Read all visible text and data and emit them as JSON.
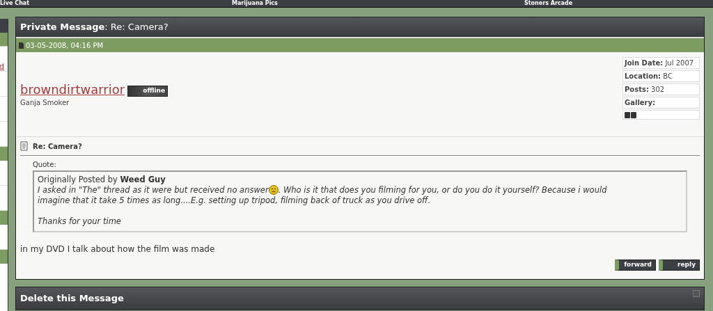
{
  "nav": [
    "Live Chat",
    "Marijuana Pics",
    "Stoners Arcade"
  ],
  "sidebar_link": "d",
  "message_panel": {
    "title_label": "Private Message",
    "title": ": Re: Camera?",
    "date": "03-05-2008, 04:16 PM",
    "user": {
      "name": "browndirtwarrior",
      "status": "offline",
      "online": false,
      "rank": "Ganja Smoker"
    },
    "info": [
      {
        "label": "Join Date:",
        "value": "Jul 2007"
      },
      {
        "label": "Location:",
        "value": "BC"
      },
      {
        "label": "Posts:",
        "value": "302"
      },
      {
        "label": "Gallery:"
      }
    ],
    "subject": "Re: Camera?",
    "quote": {
      "label": "Quote:",
      "by_prefix": "Originally Posted by",
      "author": "Weed Guy",
      "text_before": "I asked in \"The\" thread as it were but received no answer",
      "text_after": ". Who is it that does you filming for you, or do you do it yourself? Because i would",
      "text_line2": "imagine that it take 5 times as long....E.g. setting up tripod, filming back of truck as you drive off.",
      "closing": "Thanks for your time"
    },
    "body": "in my DVD I talk about how the film was made",
    "buttons": [
      "forward",
      "reply"
    ]
  },
  "delete_panel": {
    "title": "Delete this Message"
  }
}
